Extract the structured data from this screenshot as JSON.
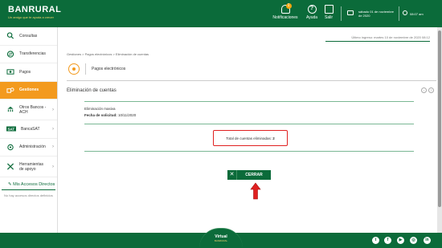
{
  "header": {
    "logo_title": "BANRURAL",
    "logo_tagline": "Un amigo que te ayuda a crecer",
    "notifications_label": "Notificaciones",
    "notifications_count": "1",
    "help_label": "Ayuda",
    "exit_label": "Salir",
    "date_line1": "sábado 01 de noviembre",
    "date_line2": "de 2020",
    "time": "08:07 am"
  },
  "sidebar": {
    "items": [
      {
        "label": "Consultas",
        "icon": "search-icon"
      },
      {
        "label": "Transferencias",
        "icon": "transfer-icon"
      },
      {
        "label": "Pagos",
        "icon": "payments-icon"
      },
      {
        "label": "Gestiones",
        "icon": "gestiones-icon"
      },
      {
        "label": "Otros Bancos - ACH",
        "icon": "bank-icon"
      },
      {
        "label": "BancaSAT",
        "icon": "sat-icon"
      },
      {
        "label": "Administración",
        "icon": "admin-icon"
      },
      {
        "label": "Herramientas de apoyo",
        "icon": "tools-icon"
      }
    ],
    "favorites_title": "Mis Accesos Directos",
    "favorites_empty": "No hay accesos directos definidos"
  },
  "main": {
    "last_login": "Último ingreso: martes 10 de noviembre de 2020 08:12",
    "breadcrumb": "Gestiones > Pagos electrónicos > Eliminación de cuentas",
    "module_label": "Pagos electrónicos",
    "section_title": "Eliminación de cuentas",
    "info_title": "Eliminación masiva",
    "date_label": "Fecha de solicitud:",
    "date_value": "10/11/2020",
    "total_label": "Total de cuentas eliminadas:",
    "total_value": "2",
    "close_label": "CERRAR"
  },
  "footer": {
    "badge_title": "Virtual",
    "badge_sub": "BANRURAL",
    "social": [
      "twitter-icon",
      "facebook-icon",
      "youtube-icon",
      "instagram-icon",
      "linkedin-icon"
    ]
  },
  "colors": {
    "brand_green": "#0b6b3a",
    "accent_orange": "#f39a1e",
    "highlight_red": "#e02020"
  }
}
